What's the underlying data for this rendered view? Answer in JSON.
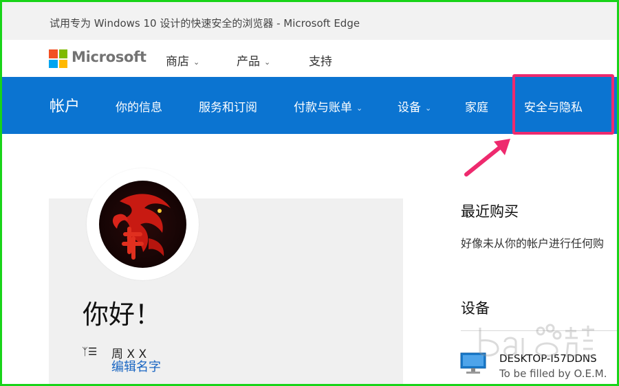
{
  "browser_banner": {
    "text": "试用专为 Windows 10 设计的快速安全的浏览器 - Microsoft Edge"
  },
  "ms_header": {
    "brand": "Microsoft",
    "nav": [
      {
        "label": "商店",
        "has_dropdown": true
      },
      {
        "label": "产品",
        "has_dropdown": true
      },
      {
        "label": "支持",
        "has_dropdown": false
      }
    ]
  },
  "account_nav": {
    "title": "帐户",
    "items": [
      {
        "label": "你的信息",
        "has_dropdown": false
      },
      {
        "label": "服务和订阅",
        "has_dropdown": false
      },
      {
        "label": "付款与账单",
        "has_dropdown": true
      },
      {
        "label": "设备",
        "has_dropdown": true
      },
      {
        "label": "家庭",
        "has_dropdown": false
      },
      {
        "label": "安全与隐私",
        "has_dropdown": false,
        "highlighted": true
      }
    ],
    "bar_color": "#0b74d1"
  },
  "profile": {
    "greeting": "你好！",
    "name_icon": "person-list-icon",
    "name": "周 X X",
    "edit_name_link": "编辑名字"
  },
  "recent_purchases": {
    "heading": "最近购买",
    "message": "好像未从你的帐户进行任何购"
  },
  "devices": {
    "heading": "设备",
    "items": [
      {
        "name": "DESKTOP-I57DDNS",
        "subtitle": "To be filled by O.E.M.",
        "icon": "desktop-icon"
      }
    ]
  },
  "annotation": {
    "highlight_color": "#ee2a6e",
    "frame_color": "#19d419"
  }
}
